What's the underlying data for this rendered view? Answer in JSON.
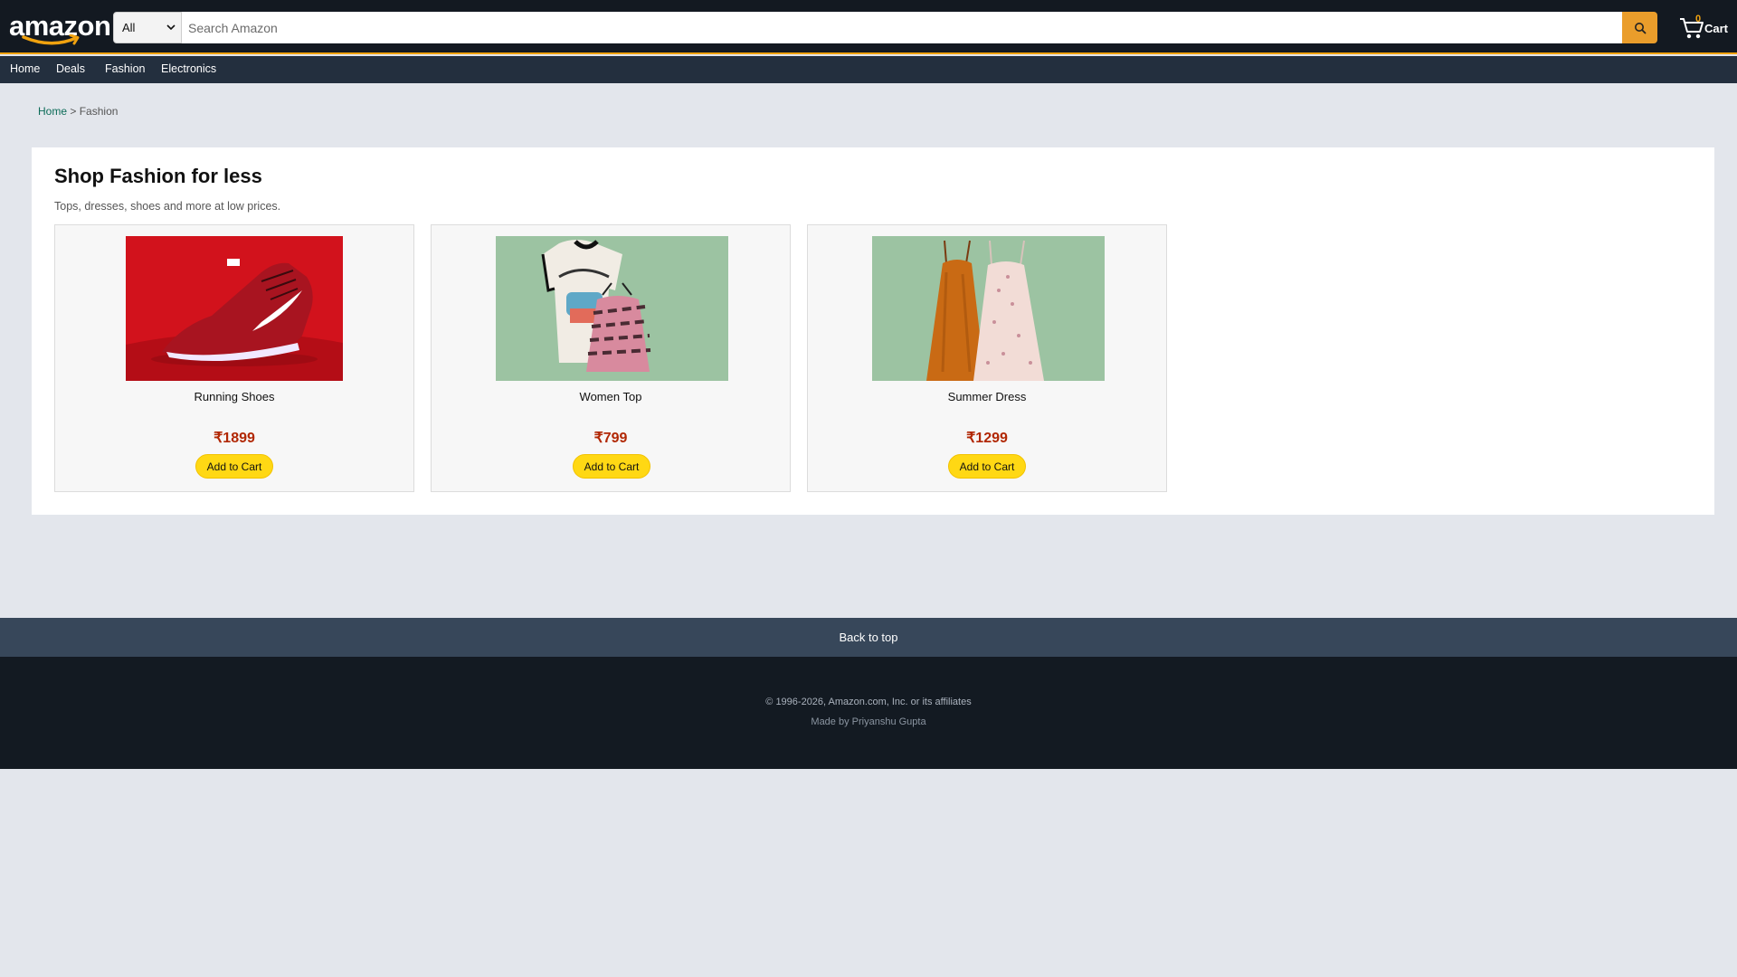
{
  "header": {
    "logo_text": "amazon",
    "search": {
      "category": "All",
      "placeholder": "Search Amazon"
    },
    "cart": {
      "count": "0",
      "label": "Cart"
    }
  },
  "nav": {
    "items": [
      "Home",
      "Deals",
      "Fashion",
      "Electronics"
    ]
  },
  "breadcrumb": {
    "home": "Home",
    "separator": ">",
    "current": "Fashion"
  },
  "main": {
    "title": "Shop Fashion for less",
    "subtitle": "Tops, dresses, shoes and more at low prices.",
    "products": [
      {
        "name": "Running Shoes",
        "price": "₹1899",
        "button": "Add to Cart",
        "image": "running-shoes-image"
      },
      {
        "name": "Women Top",
        "price": "₹799",
        "button": "Add to Cart",
        "image": "women-top-image"
      },
      {
        "name": "Summer Dress",
        "price": "₹1299",
        "button": "Add to Cart",
        "image": "summer-dress-image"
      }
    ]
  },
  "footer": {
    "back_to_top": "Back to top",
    "copyright": "© 1996-2026, Amazon.com, Inc. or its affiliates",
    "made_by": "Made by Priyanshu Gupta"
  },
  "colors": {
    "header_bg": "#131921",
    "nav_bg": "#232f3e",
    "accent": "#f0a20f",
    "price": "#b12704",
    "button": "#ffd814",
    "page_bg": "#e3e6ec"
  }
}
